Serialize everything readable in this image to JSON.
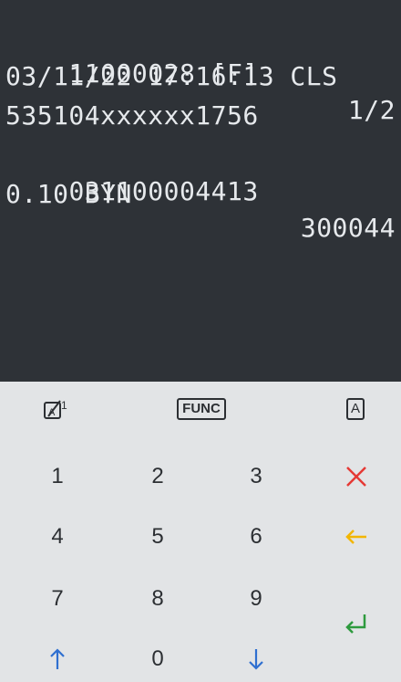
{
  "display": {
    "line1_left": "11000028 [F]",
    "line1_right": "1/2",
    "line2": "03/11/22 17:16:13 CLS",
    "line3": "535104xxxxxx1756",
    "line4_left": "031100004413",
    "line4_right": "300044",
    "line5": "0.10 BYN"
  },
  "keypad": {
    "func_label": "FUNC",
    "alpha_label": "A",
    "digits": [
      "1",
      "2",
      "3",
      "4",
      "5",
      "6",
      "7",
      "8",
      "9",
      "0"
    ]
  },
  "colors": {
    "screen_bg": "#2e3237",
    "keypad_bg": "#e2e4e6",
    "cancel": "#e53935",
    "clear": "#f2b600",
    "enter": "#2e9a3e",
    "arrows": "#2f6fd0"
  },
  "icons": {
    "mode": "alpha-numeric-toggle-icon",
    "cancel": "x-icon",
    "clear": "arrow-left-icon",
    "enter": "enter-return-icon",
    "up": "arrow-up-icon",
    "down": "arrow-down-icon"
  }
}
